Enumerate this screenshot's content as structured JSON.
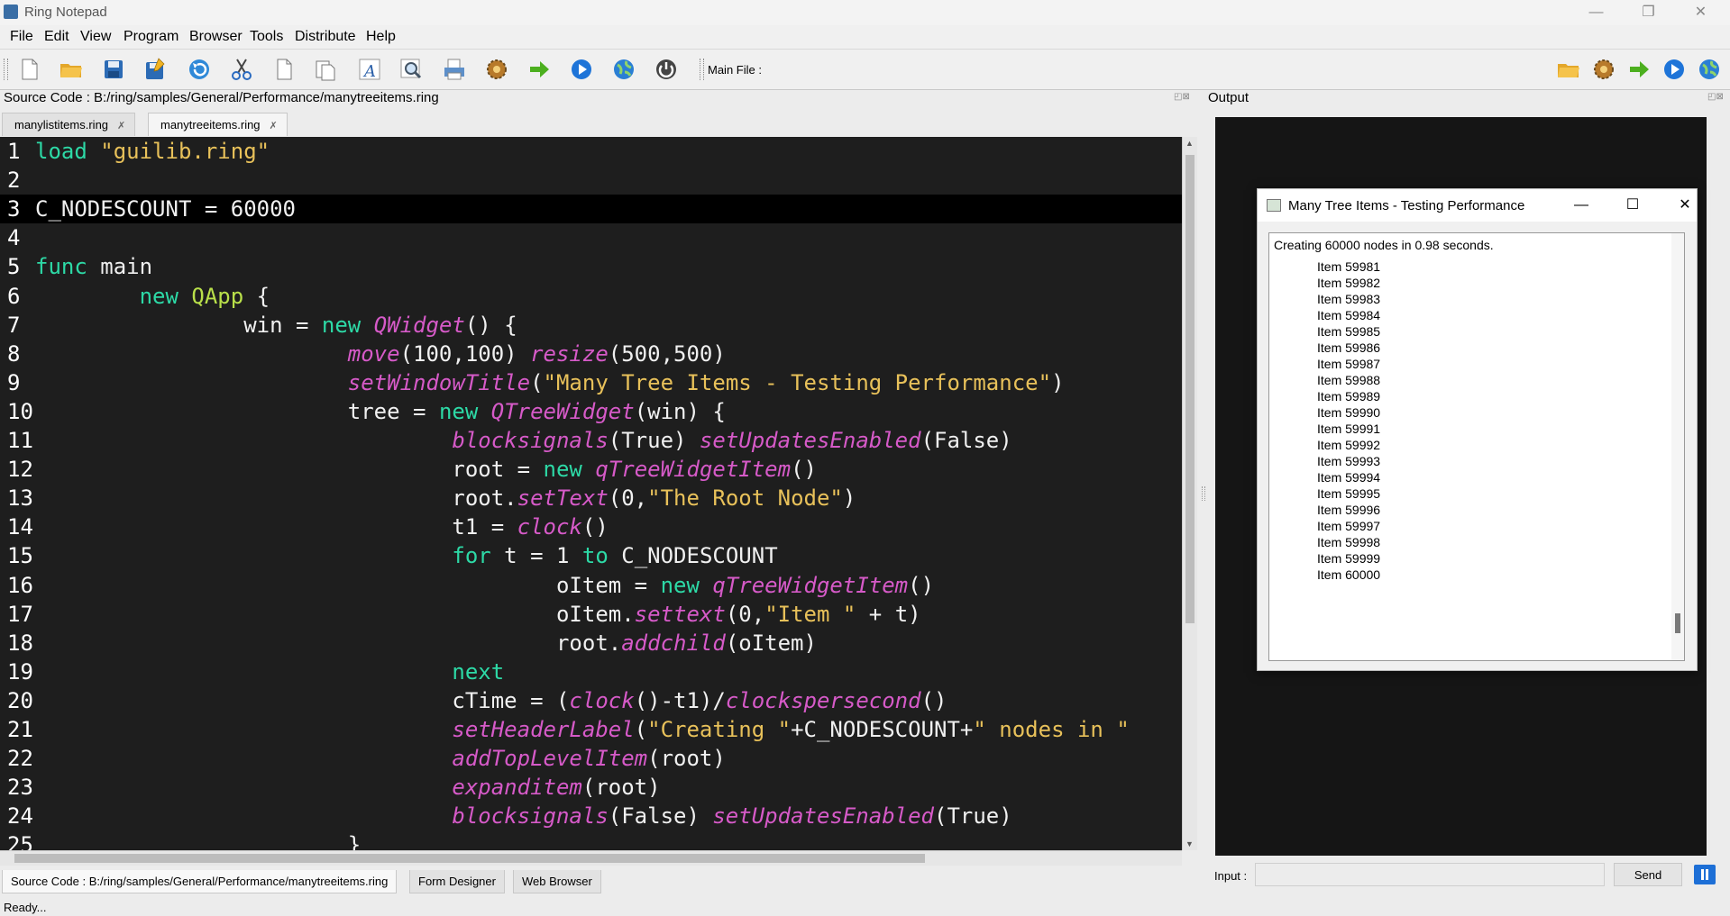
{
  "window": {
    "title": "Ring Notepad",
    "minimize": "—",
    "restore": "❐",
    "close": "✕"
  },
  "menu": [
    "File",
    "Edit",
    "View",
    "Program",
    "Browser",
    "Tools",
    "Distribute",
    "Help"
  ],
  "toolbar": {
    "main_file_label": "Main File :",
    "icons": [
      "new-file-icon",
      "open-folder-icon",
      "save-icon",
      "save-as-icon",
      "undo-icon",
      "cut-icon",
      "copy-icon",
      "paste-icon",
      "font-icon",
      "find-icon",
      "print-icon",
      "settings-icon",
      "run-arrow-icon",
      "run-play-icon",
      "web-globe-icon",
      "power-icon"
    ],
    "right_icons": [
      "open-folder-icon",
      "settings-icon",
      "run-arrow-icon",
      "run-play-icon",
      "web-globe-icon"
    ]
  },
  "source_panel": {
    "title": "Source Code : B:/ring/samples/General/Performance/manytreeitems.ring",
    "tabs": [
      {
        "label": "manylistitems.ring",
        "close": "✗"
      },
      {
        "label": "manytreeitems.ring",
        "close": "✗"
      }
    ]
  },
  "editor": {
    "lines": [
      {
        "n": "1",
        "segs": [
          [
            "kw",
            "load"
          ],
          [
            "p",
            " "
          ],
          [
            "str",
            "\"guilib.ring\""
          ]
        ]
      },
      {
        "n": "2",
        "segs": []
      },
      {
        "n": "3",
        "segs": [
          [
            "p",
            "C_NODESCOUNT = 60000"
          ]
        ]
      },
      {
        "n": "4",
        "segs": []
      },
      {
        "n": "5",
        "segs": [
          [
            "kw",
            "func"
          ],
          [
            "p",
            " main"
          ]
        ]
      },
      {
        "n": "6",
        "segs": [
          [
            "p",
            "        "
          ],
          [
            "kw",
            "new"
          ],
          [
            "p",
            " "
          ],
          [
            "qapp",
            "QApp"
          ],
          [
            "p",
            " {"
          ]
        ]
      },
      {
        "n": "7",
        "segs": [
          [
            "p",
            "                win = "
          ],
          [
            "kw",
            "new"
          ],
          [
            "p",
            " "
          ],
          [
            "cls",
            "QWidget"
          ],
          [
            "p",
            "() {"
          ]
        ]
      },
      {
        "n": "8",
        "segs": [
          [
            "p",
            "                        "
          ],
          [
            "fn",
            "move"
          ],
          [
            "p",
            "(100,100) "
          ],
          [
            "fn",
            "resize"
          ],
          [
            "p",
            "(500,500)"
          ]
        ]
      },
      {
        "n": "9",
        "segs": [
          [
            "p",
            "                        "
          ],
          [
            "fn",
            "setWindowTitle"
          ],
          [
            "p",
            "("
          ],
          [
            "str",
            "\"Many Tree Items - Testing Performance\""
          ],
          [
            "p",
            ")"
          ]
        ]
      },
      {
        "n": "10",
        "segs": [
          [
            "p",
            "                        tree = "
          ],
          [
            "kw",
            "new"
          ],
          [
            "p",
            " "
          ],
          [
            "cls",
            "QTreeWidget"
          ],
          [
            "p",
            "(win) {"
          ]
        ]
      },
      {
        "n": "11",
        "segs": [
          [
            "p",
            "                                "
          ],
          [
            "fn",
            "blocksignals"
          ],
          [
            "p",
            "(True) "
          ],
          [
            "fn",
            "setUpdatesEnabled"
          ],
          [
            "p",
            "(False)"
          ]
        ]
      },
      {
        "n": "12",
        "segs": [
          [
            "p",
            "                                root = "
          ],
          [
            "kw",
            "new"
          ],
          [
            "p",
            " "
          ],
          [
            "cls",
            "qTreeWidgetItem"
          ],
          [
            "p",
            "()"
          ]
        ]
      },
      {
        "n": "13",
        "segs": [
          [
            "p",
            "                                root."
          ],
          [
            "fn",
            "setText"
          ],
          [
            "p",
            "(0,"
          ],
          [
            "str",
            "\"The Root Node\""
          ],
          [
            "p",
            ")"
          ]
        ]
      },
      {
        "n": "14",
        "segs": [
          [
            "p",
            "                                t1 = "
          ],
          [
            "fn",
            "clock"
          ],
          [
            "p",
            "()"
          ]
        ]
      },
      {
        "n": "15",
        "segs": [
          [
            "p",
            "                                "
          ],
          [
            "kw",
            "for"
          ],
          [
            "p",
            " t = 1 "
          ],
          [
            "kw",
            "to"
          ],
          [
            "p",
            " C_NODESCOUNT"
          ]
        ]
      },
      {
        "n": "16",
        "segs": [
          [
            "p",
            "                                        oItem = "
          ],
          [
            "kw",
            "new"
          ],
          [
            "p",
            " "
          ],
          [
            "cls",
            "qTreeWidgetItem"
          ],
          [
            "p",
            "()"
          ]
        ]
      },
      {
        "n": "17",
        "segs": [
          [
            "p",
            "                                        oItem."
          ],
          [
            "fn",
            "settext"
          ],
          [
            "p",
            "(0,"
          ],
          [
            "str",
            "\"Item \""
          ],
          [
            "p",
            " + t)"
          ]
        ]
      },
      {
        "n": "18",
        "segs": [
          [
            "p",
            "                                        root."
          ],
          [
            "fn",
            "addchild"
          ],
          [
            "p",
            "(oItem)"
          ]
        ]
      },
      {
        "n": "19",
        "segs": [
          [
            "p",
            "                                "
          ],
          [
            "kw",
            "next"
          ]
        ]
      },
      {
        "n": "20",
        "segs": [
          [
            "p",
            "                                cTime = ("
          ],
          [
            "fn",
            "clock"
          ],
          [
            "p",
            "()-t1)/"
          ],
          [
            "fn",
            "clockspersecond"
          ],
          [
            "p",
            "()"
          ]
        ]
      },
      {
        "n": "21",
        "segs": [
          [
            "p",
            "                                "
          ],
          [
            "fn",
            "setHeaderLabel"
          ],
          [
            "p",
            "("
          ],
          [
            "str",
            "\"Creating \""
          ],
          [
            "p",
            "+C_NODESCOUNT+"
          ],
          [
            "str",
            "\" nodes in \""
          ]
        ]
      },
      {
        "n": "22",
        "segs": [
          [
            "p",
            "                                "
          ],
          [
            "fn",
            "addTopLevelItem"
          ],
          [
            "p",
            "(root)"
          ]
        ]
      },
      {
        "n": "23",
        "segs": [
          [
            "p",
            "                                "
          ],
          [
            "fn",
            "expanditem"
          ],
          [
            "p",
            "(root)"
          ]
        ]
      },
      {
        "n": "24",
        "segs": [
          [
            "p",
            "                                "
          ],
          [
            "fn",
            "blocksignals"
          ],
          [
            "p",
            "(False) "
          ],
          [
            "fn",
            "setUpdatesEnabled"
          ],
          [
            "p",
            "(True)"
          ]
        ]
      },
      {
        "n": "25",
        "segs": [
          [
            "p",
            "                        }"
          ]
        ]
      }
    ],
    "current_line": "3",
    "colors": {
      "keyword": "#2dd9a6",
      "string": "#e8c15a",
      "function": "#d65ac8",
      "class_qapp": "#b9e04a",
      "background": "#1e1e1e"
    }
  },
  "bottom_tabs": [
    "Source Code : B:/ring/samples/General/Performance/manytreeitems.ring",
    "Form Designer",
    "Web Browser"
  ],
  "status": "Ready...",
  "output_panel": {
    "title": "Output",
    "input_label": "Input :",
    "send_label": "Send"
  },
  "app_window": {
    "title": "Many Tree Items - Testing Performance",
    "minimize": "—",
    "maximize": "☐",
    "close": "✕",
    "tree_header": "Creating 60000 nodes in 0.98 seconds.",
    "items": [
      "Item 59981",
      "Item 59982",
      "Item 59983",
      "Item 59984",
      "Item 59985",
      "Item 59986",
      "Item 59987",
      "Item 59988",
      "Item 59989",
      "Item 59990",
      "Item 59991",
      "Item 59992",
      "Item 59993",
      "Item 59994",
      "Item 59995",
      "Item 59996",
      "Item 59997",
      "Item 59998",
      "Item 59999",
      "Item 60000"
    ]
  }
}
